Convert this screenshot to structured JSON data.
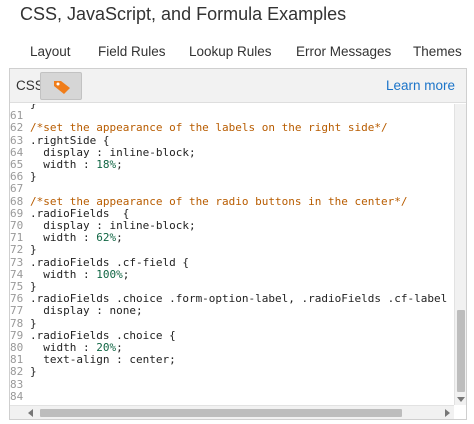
{
  "page": {
    "title": "CSS, JavaScript, and Formula Examples"
  },
  "tabs": [
    {
      "label": "Layout"
    },
    {
      "label": "Field Rules"
    },
    {
      "label": "Lookup Rules"
    },
    {
      "label": "Error Messages"
    },
    {
      "label": "Themes"
    }
  ],
  "css_panel": {
    "label": "CSS",
    "tag_icon": "tag-icon",
    "tag_icon_color": "#f07d1a",
    "learn_more": "Learn more",
    "link_color": "#1b74c9"
  },
  "editor": {
    "lines": [
      {
        "num": "",
        "text": "}",
        "type": "code"
      },
      {
        "num": "61",
        "text": "",
        "type": "code"
      },
      {
        "num": "62",
        "text": "/*set the appearance of the labels on the right side*/",
        "type": "comment"
      },
      {
        "num": "63",
        "text": ".rightSide {",
        "type": "code"
      },
      {
        "num": "64",
        "text": "  display : inline-block;",
        "type": "code"
      },
      {
        "num": "65",
        "text": "  width : ",
        "num_value": "18%",
        "after": ";",
        "type": "numeric"
      },
      {
        "num": "66",
        "text": "}",
        "type": "code"
      },
      {
        "num": "67",
        "text": "",
        "type": "code"
      },
      {
        "num": "68",
        "text": "/*set the appearance of the radio buttons in the center*/",
        "type": "comment"
      },
      {
        "num": "69",
        "text": ".radioFields  {",
        "type": "code"
      },
      {
        "num": "70",
        "text": "  display : inline-block;",
        "type": "code"
      },
      {
        "num": "71",
        "text": "  width : ",
        "num_value": "62%",
        "after": ";",
        "type": "numeric"
      },
      {
        "num": "72",
        "text": "}",
        "type": "code"
      },
      {
        "num": "73",
        "text": ".radioFields .cf-field {",
        "type": "code"
      },
      {
        "num": "74",
        "text": "  width : ",
        "num_value": "100%",
        "after": ";",
        "type": "numeric"
      },
      {
        "num": "75",
        "text": "}",
        "type": "code"
      },
      {
        "num": "76",
        "text": ".radioFields .choice .form-option-label, .radioFields .cf-label",
        "type": "code"
      },
      {
        "num": "77",
        "text": "  display : none;",
        "type": "code"
      },
      {
        "num": "78",
        "text": "}",
        "type": "code"
      },
      {
        "num": "79",
        "text": ".radioFields .choice {",
        "type": "code"
      },
      {
        "num": "80",
        "text": "  width : ",
        "num_value": "20%",
        "after": ";",
        "type": "numeric"
      },
      {
        "num": "81",
        "text": "  text-align : center;",
        "type": "code"
      },
      {
        "num": "82",
        "text": "}",
        "type": "code"
      },
      {
        "num": "83",
        "text": "",
        "type": "code"
      },
      {
        "num": "84",
        "text": "",
        "type": "code"
      }
    ],
    "comment_color": "#b85c00",
    "number_color": "#116644"
  }
}
